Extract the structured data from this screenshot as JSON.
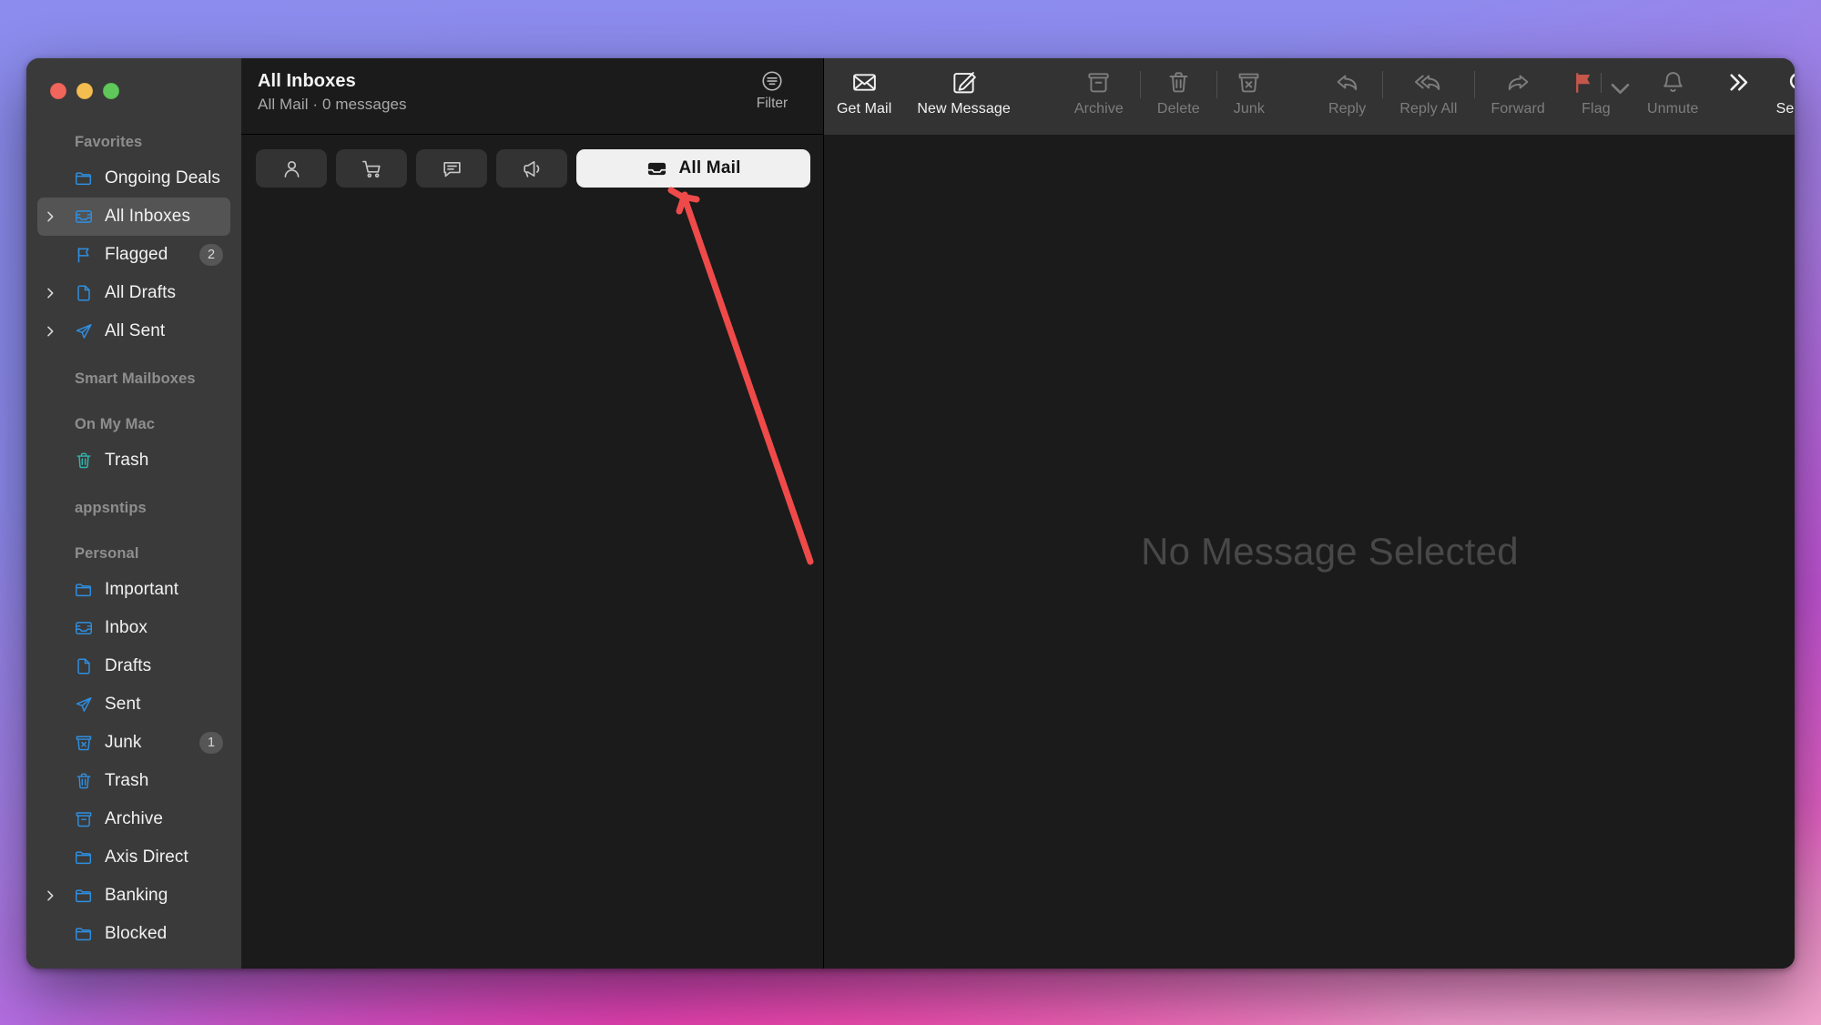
{
  "window": {
    "traffic_lights": [
      {
        "name": "close",
        "color": "#f2655c"
      },
      {
        "name": "minimize",
        "color": "#f4bd4f"
      },
      {
        "name": "zoom",
        "color": "#5ec85a"
      }
    ]
  },
  "sidebar": {
    "groups": [
      {
        "title": "Favorites",
        "items": [
          {
            "label": "Ongoing Deals",
            "icon": "folder-icon",
            "chevron": false,
            "badge": null,
            "selected": false
          },
          {
            "label": "All Inboxes",
            "icon": "inbox-icon",
            "chevron": true,
            "badge": null,
            "selected": true
          },
          {
            "label": "Flagged",
            "icon": "flag-icon",
            "chevron": false,
            "badge": "2",
            "selected": false
          },
          {
            "label": "All Drafts",
            "icon": "draft-icon",
            "chevron": true,
            "badge": null,
            "selected": false
          },
          {
            "label": "All Sent",
            "icon": "sent-icon",
            "chevron": true,
            "badge": null,
            "selected": false
          }
        ]
      },
      {
        "title": "Smart Mailboxes",
        "items": []
      },
      {
        "title": "On My Mac",
        "items": [
          {
            "label": "Trash",
            "icon": "trash-icon",
            "chevron": false,
            "badge": null,
            "selected": false,
            "tint": "teal"
          }
        ]
      },
      {
        "title": "appsntips",
        "items": []
      },
      {
        "title": "Personal",
        "items": [
          {
            "label": "Important",
            "icon": "folder-icon",
            "chevron": false,
            "badge": null,
            "selected": false
          },
          {
            "label": "Inbox",
            "icon": "inbox-icon",
            "chevron": false,
            "badge": null,
            "selected": false
          },
          {
            "label": "Drafts",
            "icon": "draft-icon",
            "chevron": false,
            "badge": null,
            "selected": false
          },
          {
            "label": "Sent",
            "icon": "sent-icon",
            "chevron": false,
            "badge": null,
            "selected": false
          },
          {
            "label": "Junk",
            "icon": "junk-icon",
            "chevron": false,
            "badge": "1",
            "selected": false
          },
          {
            "label": "Trash",
            "icon": "trash-icon",
            "chevron": false,
            "badge": null,
            "selected": false
          },
          {
            "label": "Archive",
            "icon": "archive-icon",
            "chevron": false,
            "badge": null,
            "selected": false
          },
          {
            "label": "Axis Direct",
            "icon": "folder-icon",
            "chevron": false,
            "badge": null,
            "selected": false
          },
          {
            "label": "Banking",
            "icon": "folder-icon",
            "chevron": true,
            "badge": null,
            "selected": false
          },
          {
            "label": "Blocked",
            "icon": "folder-icon",
            "chevron": false,
            "badge": null,
            "selected": false
          }
        ]
      }
    ]
  },
  "list_header": {
    "title": "All Inboxes",
    "subtitle": "All Mail · 0 messages",
    "filter_label": "Filter",
    "filter_icon": "filter-icon"
  },
  "filter_pills": [
    {
      "name": "contacts-pill",
      "icon": "person-icon",
      "label": "",
      "active": false
    },
    {
      "name": "transactions-pill",
      "icon": "cart-icon",
      "label": "",
      "active": false
    },
    {
      "name": "updates-pill",
      "icon": "chat-bubble-icon",
      "label": "",
      "active": false
    },
    {
      "name": "promotions-pill",
      "icon": "megaphone-icon",
      "label": "",
      "active": false
    },
    {
      "name": "all-mail-pill",
      "icon": "all-mail-icon",
      "label": "All Mail",
      "active": true
    }
  ],
  "toolbar": {
    "items": [
      {
        "label": "Get Mail",
        "icon": "envelope-icon",
        "enabled": true
      },
      {
        "label": "New Message",
        "icon": "compose-icon",
        "enabled": true
      },
      {
        "label": "Archive",
        "icon": "archive-icon",
        "enabled": false
      },
      {
        "label": "Delete",
        "icon": "trash-icon",
        "enabled": false
      },
      {
        "label": "Junk",
        "icon": "junk-icon",
        "enabled": false
      },
      {
        "label": "Reply",
        "icon": "reply-icon",
        "enabled": false
      },
      {
        "label": "Reply All",
        "icon": "reply-all-icon",
        "enabled": false
      },
      {
        "label": "Forward",
        "icon": "forward-icon",
        "enabled": false
      },
      {
        "label": "Flag",
        "icon": "flag-icon",
        "enabled": false
      },
      {
        "label": "Unmute",
        "icon": "bell-icon",
        "enabled": false
      },
      {
        "label": "",
        "icon": "chevron-double-right-icon",
        "enabled": true
      },
      {
        "label": "Search",
        "icon": "search-icon",
        "enabled": true
      }
    ],
    "flag_color": "#c4564a"
  },
  "reading_pane": {
    "empty_state": "No Message Selected"
  },
  "annotation": {
    "arrow_color": "#ef4a4a",
    "points_to": "All Mail pill"
  }
}
